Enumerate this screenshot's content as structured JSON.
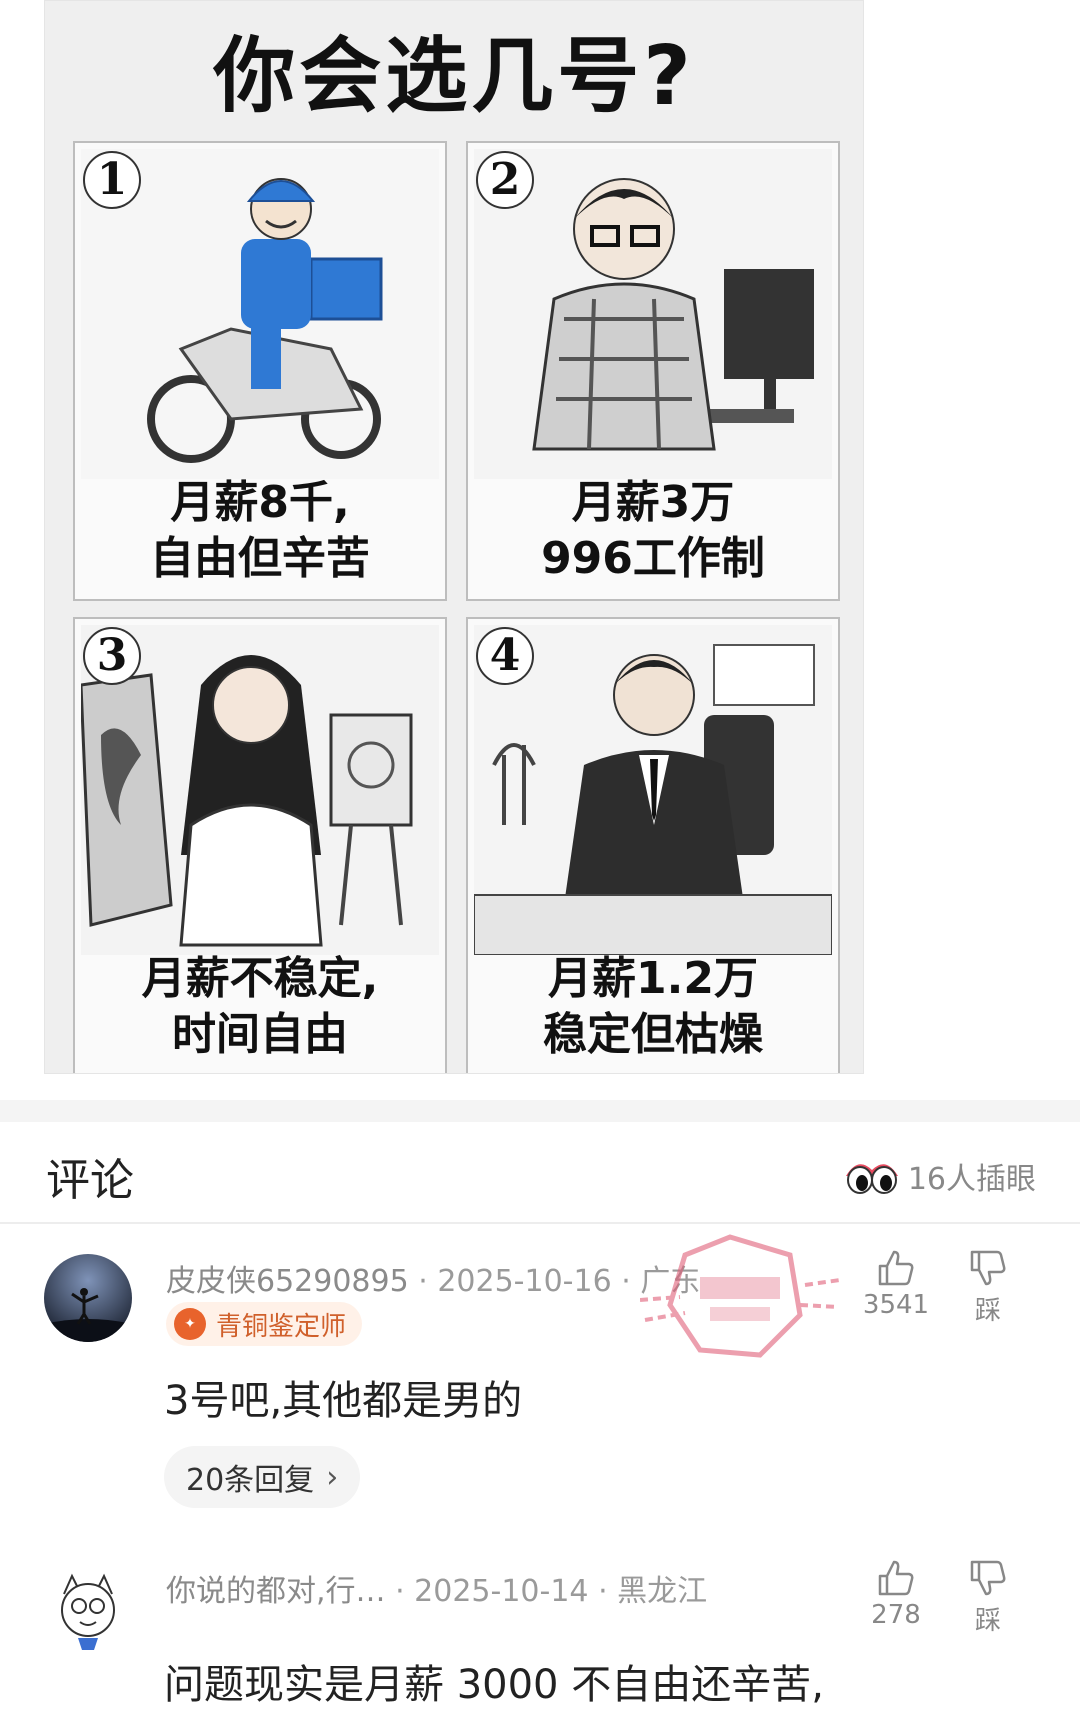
{
  "post_image": {
    "title": "你会选几号?",
    "panels": [
      {
        "number": "1",
        "caption_line1": "月薪8千,",
        "caption_line2": "自由但辛苦"
      },
      {
        "number": "2",
        "caption_line1": "月薪3万",
        "caption_line2": "996工作制"
      },
      {
        "number": "3",
        "caption_line1": "月薪不稳定,",
        "caption_line2": "时间自由"
      },
      {
        "number": "4",
        "caption_line1": "月薪1.2万",
        "caption_line2": "稳定但枯燥"
      }
    ]
  },
  "comments_header": {
    "title": "评论",
    "peek_icon": "eyes-icon",
    "peek_label": "16人插眼"
  },
  "comments": [
    {
      "username": "皮皮侠65290895",
      "date": "2025-10-16",
      "location": "广东",
      "badge": "青铜鉴定师",
      "text": "3号吧,其他都是男的",
      "likes": "3541",
      "dislike_label": "踩",
      "replies": "20条回复"
    },
    {
      "username": "你说的都对,行…",
      "date": "2025-10-14",
      "location": "黑龙江",
      "text": "问题现实是月薪 3000 不自由还辛苦,",
      "likes": "278",
      "dislike_label": "踩"
    }
  ],
  "colors": {
    "accent": "#e8632c",
    "badge_bg": "#fff1e8",
    "meta_text": "#9a9a9a",
    "stamp": "#e0607a"
  }
}
